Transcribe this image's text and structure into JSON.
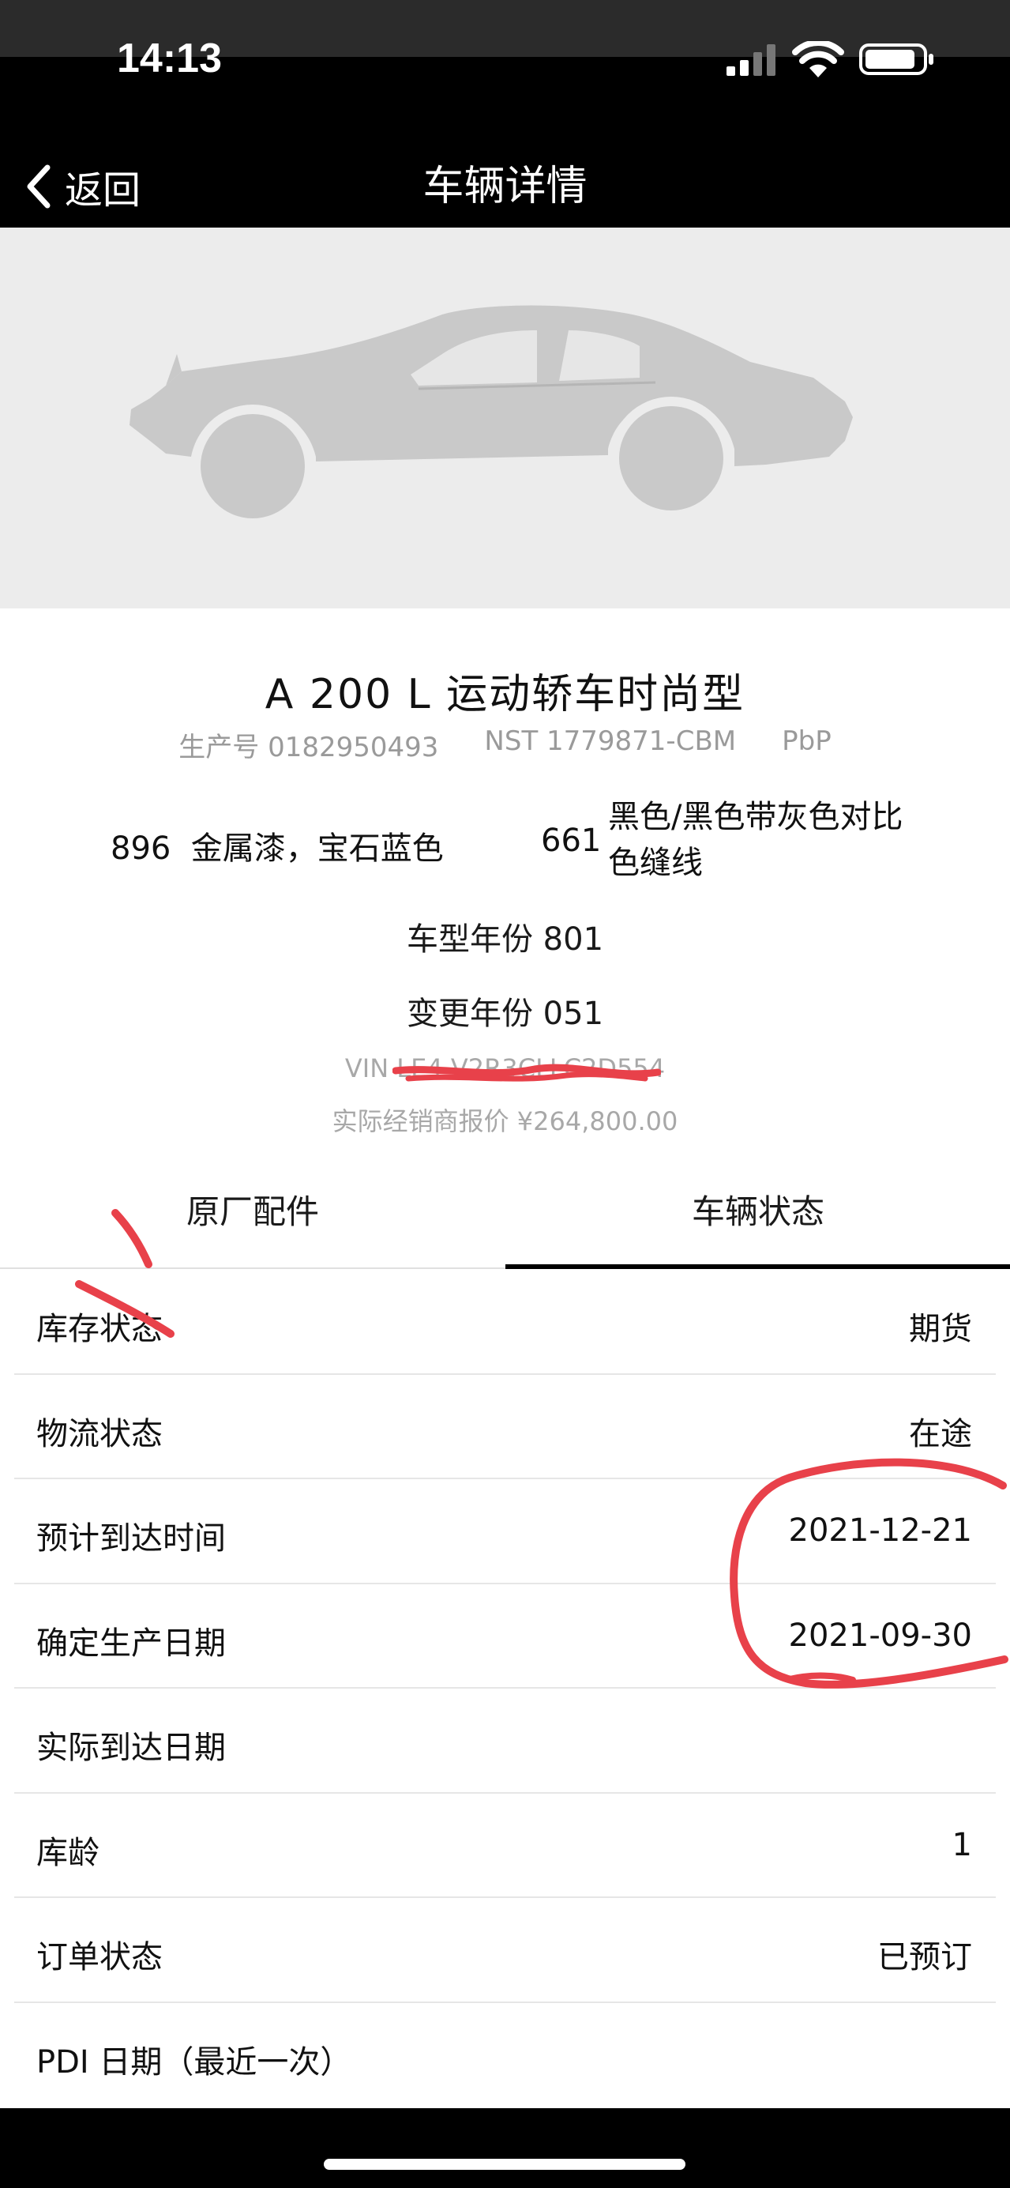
{
  "status_bar": {
    "time": "14:13",
    "icons": [
      "signal-icon",
      "wifi-icon",
      "battery-icon"
    ]
  },
  "nav": {
    "back_label": "返回",
    "title": "车辆详情",
    "back_icon": "chevron-left-icon"
  },
  "vehicle": {
    "image": "car-silhouette",
    "model_name": "A 200 L 运动轿车时尚型",
    "production_no": "生产号 0182950493",
    "nst": "NST 1779871-CBM",
    "pbp": "PbP",
    "paint_code": "896",
    "paint_name": "金属漆，宝石蓝色",
    "upholstery_code": "661",
    "upholstery_name": "黑色/黑色带灰色对比色缝线",
    "model_year": "车型年份 801",
    "change_year": "变更年份 051",
    "vin": "VIN LE4",
    "dealer_price": "实际经销商报价 ¥264,800.00"
  },
  "tabs": [
    {
      "label": "原厂配件",
      "active": false
    },
    {
      "label": "车辆状态",
      "active": true
    }
  ],
  "status_rows": [
    {
      "label": "库存状态",
      "value": "期货"
    },
    {
      "label": "物流状态",
      "value": "在途"
    },
    {
      "label": "预计到达时间",
      "value": "2021-12-21"
    },
    {
      "label": "确定生产日期",
      "value": "2021-09-30"
    },
    {
      "label": "实际到达日期",
      "value": ""
    },
    {
      "label": "库龄",
      "value": "1"
    },
    {
      "label": "订单状态",
      "value": "已预订"
    },
    {
      "label": "PDI 日期（最近一次）",
      "value": ""
    }
  ],
  "colors": {
    "header_bg": "#000000",
    "hero_bg": "#ececec",
    "muted_text": "#9a9a9a",
    "annotation": "#e8414a"
  }
}
